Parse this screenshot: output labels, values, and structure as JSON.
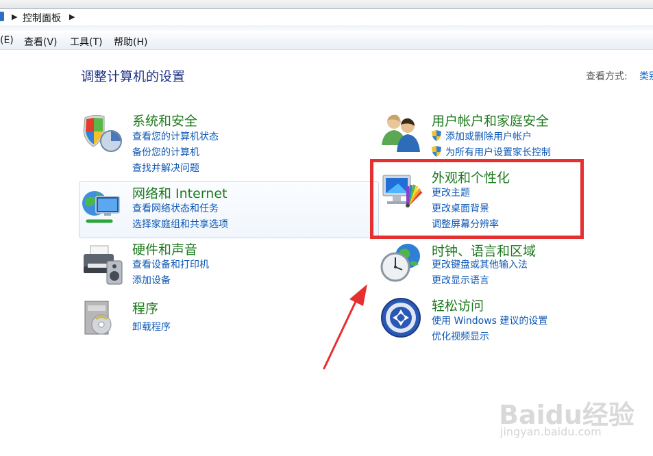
{
  "address": {
    "crumb": "控制面板"
  },
  "menu": {
    "items": [
      "(E)",
      "查看(V)",
      "工具(T)",
      "帮助(H)"
    ]
  },
  "header": {
    "title": "调整计算机的设置",
    "viewby_label": "查看方式:",
    "viewby_value": "类别"
  },
  "categories": {
    "system": {
      "title": "系统和安全",
      "links": [
        "查看您的计算机状态",
        "备份您的计算机",
        "查找并解决问题"
      ]
    },
    "network": {
      "title": "网络和 Internet",
      "links": [
        "查看网络状态和任务",
        "选择家庭组和共享选项"
      ]
    },
    "hardware": {
      "title": "硬件和声音",
      "links": [
        "查看设备和打印机",
        "添加设备"
      ]
    },
    "programs": {
      "title": "程序",
      "links": [
        "卸载程序"
      ]
    },
    "users": {
      "title": "用户帐户和家庭安全",
      "links": [
        "添加或删除用户帐户",
        "为所有用户设置家长控制"
      ]
    },
    "appearance": {
      "title": "外观和个性化",
      "links": [
        "更改主题",
        "更改桌面背景",
        "调整屏幕分辨率"
      ]
    },
    "clock": {
      "title": "时钟、语言和区域",
      "links": [
        "更改键盘或其他输入法",
        "更改显示语言"
      ]
    },
    "ease": {
      "title": "轻松访问",
      "links": [
        "使用 Windows 建议的设置",
        "优化视频显示"
      ]
    }
  },
  "colors": {
    "accent_red": "#e63030",
    "category_green": "#1e7a1e",
    "link_blue": "#0e58b5"
  },
  "watermark": {
    "brand": "Baidu经验",
    "url": "jingyan.baidu.com"
  }
}
